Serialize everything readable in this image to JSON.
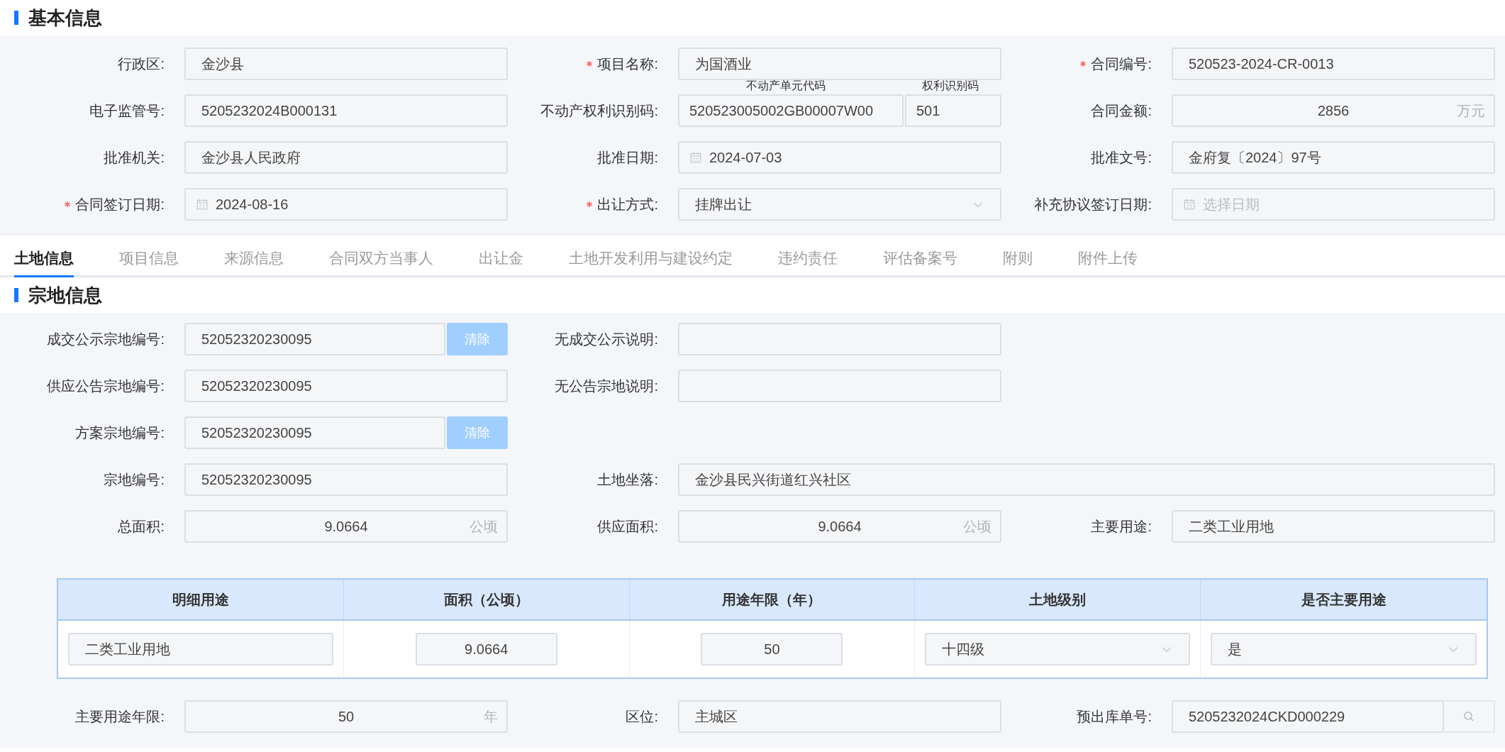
{
  "basic": {
    "title": "基本信息",
    "rows": [
      [
        {
          "label": "行政区:",
          "required": false,
          "kind": "text",
          "value": "金沙县"
        },
        {
          "label": "项目名称:",
          "required": true,
          "kind": "text",
          "value": "为国酒业"
        },
        {
          "label": "合同编号:",
          "required": true,
          "kind": "text",
          "value": "520523-2024-CR-0013"
        }
      ],
      [
        {
          "label": "电子监管号:",
          "required": false,
          "kind": "text",
          "value": "5205232024B000131"
        },
        {
          "label": "不动产权利识别码:",
          "required": false,
          "kind": "split",
          "parts": [
            {
              "caption": "不动产单元代码",
              "value": "520523005002GB00007W00"
            },
            {
              "caption": "权利识别码",
              "value": "501"
            }
          ]
        },
        {
          "label": "合同金额:",
          "required": false,
          "kind": "unit",
          "value": "2856",
          "unit": "万元"
        }
      ],
      [
        {
          "label": "批准机关:",
          "required": false,
          "kind": "text",
          "value": "金沙县人民政府"
        },
        {
          "label": "批准日期:",
          "required": false,
          "kind": "date",
          "value": "2024-07-03"
        },
        {
          "label": "批准文号:",
          "required": false,
          "kind": "text",
          "value": "金府复〔2024〕97号"
        }
      ],
      [
        {
          "label": "合同签订日期:",
          "required": true,
          "kind": "date",
          "value": "2024-08-16"
        },
        {
          "label": "出让方式:",
          "required": true,
          "kind": "select",
          "value": "挂牌出让"
        },
        {
          "label": "补充协议签订日期:",
          "required": false,
          "kind": "date",
          "placeholder": "选择日期"
        }
      ]
    ]
  },
  "tabs": [
    {
      "label": "土地信息",
      "selected": true
    },
    {
      "label": "项目信息",
      "selected": false
    },
    {
      "label": "来源信息",
      "selected": false
    },
    {
      "label": "合同双方当事人",
      "selected": false
    },
    {
      "label": "出让金",
      "selected": false
    },
    {
      "label": "土地开发利用与建设约定",
      "selected": false
    },
    {
      "label": "违约责任",
      "selected": false
    },
    {
      "label": "评估备案号",
      "selected": false
    },
    {
      "label": "附则",
      "selected": false
    },
    {
      "label": "附件上传",
      "selected": false
    }
  ],
  "parcel": {
    "title": "宗地信息",
    "rows": [
      [
        {
          "label": "成交公示宗地编号:",
          "kind": "clearable",
          "value": "52052320230095",
          "button": "清除"
        },
        {
          "label": "无成交公示说明:",
          "kind": "text"
        }
      ],
      [
        {
          "label": "供应公告宗地编号:",
          "kind": "text",
          "value": "52052320230095"
        },
        {
          "label": "无公告宗地说明:",
          "kind": "text"
        }
      ],
      [
        {
          "label": "方案宗地编号:",
          "kind": "clearable",
          "value": "52052320230095",
          "button": "清除"
        }
      ],
      [
        {
          "label": "宗地编号:",
          "kind": "text",
          "value": "52052320230095"
        },
        {
          "label": "土地坐落:",
          "kind": "wide",
          "value": "金沙县民兴街道红兴社区"
        }
      ],
      [
        {
          "label": "总面积:",
          "kind": "unit",
          "value": "9.0664",
          "unit": "公顷"
        },
        {
          "label": "供应面积:",
          "kind": "unit",
          "value": "9.0664",
          "unit": "公顷"
        },
        {
          "label": "主要用途:",
          "kind": "text",
          "value": "二类工业用地"
        }
      ]
    ],
    "table": {
      "columns": [
        "明细用途",
        "面积（公顷）",
        "用途年限（年）",
        "土地级别",
        "是否主要用途"
      ],
      "rows": [
        [
          {
            "kind": "text",
            "value": "二类工业用地"
          },
          {
            "kind": "number",
            "value": "9.0664"
          },
          {
            "kind": "number",
            "value": "50"
          },
          {
            "kind": "select",
            "value": "十四级"
          },
          {
            "kind": "select",
            "value": "是"
          }
        ]
      ]
    },
    "rows_after": [
      [
        {
          "label": "主要用途年限:",
          "kind": "unit",
          "value": "50",
          "unit": "年"
        },
        {
          "label": "区位:",
          "kind": "text",
          "value": "主城区"
        },
        {
          "label": "预出库单号:",
          "kind": "search",
          "value": "5205232024CKD000229"
        }
      ]
    ]
  }
}
